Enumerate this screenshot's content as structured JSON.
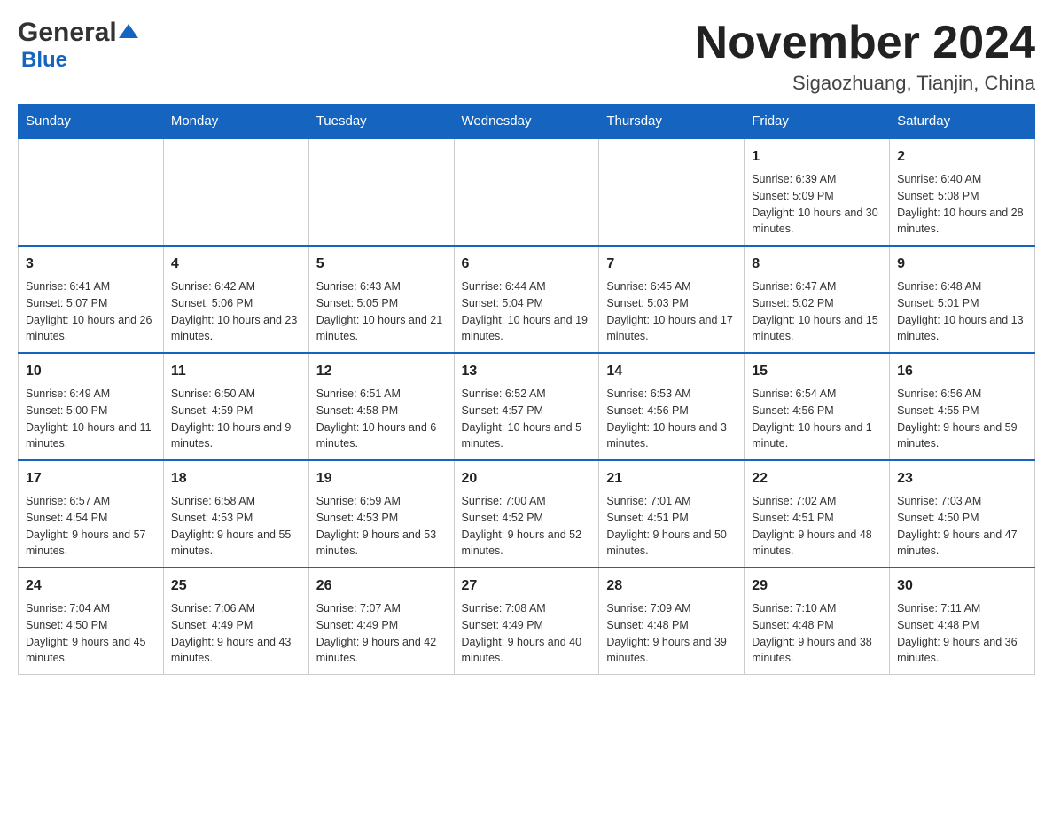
{
  "logo": {
    "text_general": "General",
    "text_blue": "Blue"
  },
  "header": {
    "month_year": "November 2024",
    "location": "Sigaozhuang, Tianjin, China"
  },
  "weekdays": [
    "Sunday",
    "Monday",
    "Tuesday",
    "Wednesday",
    "Thursday",
    "Friday",
    "Saturday"
  ],
  "weeks": [
    [
      {
        "day": "",
        "info": ""
      },
      {
        "day": "",
        "info": ""
      },
      {
        "day": "",
        "info": ""
      },
      {
        "day": "",
        "info": ""
      },
      {
        "day": "",
        "info": ""
      },
      {
        "day": "1",
        "info": "Sunrise: 6:39 AM\nSunset: 5:09 PM\nDaylight: 10 hours and 30 minutes."
      },
      {
        "day": "2",
        "info": "Sunrise: 6:40 AM\nSunset: 5:08 PM\nDaylight: 10 hours and 28 minutes."
      }
    ],
    [
      {
        "day": "3",
        "info": "Sunrise: 6:41 AM\nSunset: 5:07 PM\nDaylight: 10 hours and 26 minutes."
      },
      {
        "day": "4",
        "info": "Sunrise: 6:42 AM\nSunset: 5:06 PM\nDaylight: 10 hours and 23 minutes."
      },
      {
        "day": "5",
        "info": "Sunrise: 6:43 AM\nSunset: 5:05 PM\nDaylight: 10 hours and 21 minutes."
      },
      {
        "day": "6",
        "info": "Sunrise: 6:44 AM\nSunset: 5:04 PM\nDaylight: 10 hours and 19 minutes."
      },
      {
        "day": "7",
        "info": "Sunrise: 6:45 AM\nSunset: 5:03 PM\nDaylight: 10 hours and 17 minutes."
      },
      {
        "day": "8",
        "info": "Sunrise: 6:47 AM\nSunset: 5:02 PM\nDaylight: 10 hours and 15 minutes."
      },
      {
        "day": "9",
        "info": "Sunrise: 6:48 AM\nSunset: 5:01 PM\nDaylight: 10 hours and 13 minutes."
      }
    ],
    [
      {
        "day": "10",
        "info": "Sunrise: 6:49 AM\nSunset: 5:00 PM\nDaylight: 10 hours and 11 minutes."
      },
      {
        "day": "11",
        "info": "Sunrise: 6:50 AM\nSunset: 4:59 PM\nDaylight: 10 hours and 9 minutes."
      },
      {
        "day": "12",
        "info": "Sunrise: 6:51 AM\nSunset: 4:58 PM\nDaylight: 10 hours and 6 minutes."
      },
      {
        "day": "13",
        "info": "Sunrise: 6:52 AM\nSunset: 4:57 PM\nDaylight: 10 hours and 5 minutes."
      },
      {
        "day": "14",
        "info": "Sunrise: 6:53 AM\nSunset: 4:56 PM\nDaylight: 10 hours and 3 minutes."
      },
      {
        "day": "15",
        "info": "Sunrise: 6:54 AM\nSunset: 4:56 PM\nDaylight: 10 hours and 1 minute."
      },
      {
        "day": "16",
        "info": "Sunrise: 6:56 AM\nSunset: 4:55 PM\nDaylight: 9 hours and 59 minutes."
      }
    ],
    [
      {
        "day": "17",
        "info": "Sunrise: 6:57 AM\nSunset: 4:54 PM\nDaylight: 9 hours and 57 minutes."
      },
      {
        "day": "18",
        "info": "Sunrise: 6:58 AM\nSunset: 4:53 PM\nDaylight: 9 hours and 55 minutes."
      },
      {
        "day": "19",
        "info": "Sunrise: 6:59 AM\nSunset: 4:53 PM\nDaylight: 9 hours and 53 minutes."
      },
      {
        "day": "20",
        "info": "Sunrise: 7:00 AM\nSunset: 4:52 PM\nDaylight: 9 hours and 52 minutes."
      },
      {
        "day": "21",
        "info": "Sunrise: 7:01 AM\nSunset: 4:51 PM\nDaylight: 9 hours and 50 minutes."
      },
      {
        "day": "22",
        "info": "Sunrise: 7:02 AM\nSunset: 4:51 PM\nDaylight: 9 hours and 48 minutes."
      },
      {
        "day": "23",
        "info": "Sunrise: 7:03 AM\nSunset: 4:50 PM\nDaylight: 9 hours and 47 minutes."
      }
    ],
    [
      {
        "day": "24",
        "info": "Sunrise: 7:04 AM\nSunset: 4:50 PM\nDaylight: 9 hours and 45 minutes."
      },
      {
        "day": "25",
        "info": "Sunrise: 7:06 AM\nSunset: 4:49 PM\nDaylight: 9 hours and 43 minutes."
      },
      {
        "day": "26",
        "info": "Sunrise: 7:07 AM\nSunset: 4:49 PM\nDaylight: 9 hours and 42 minutes."
      },
      {
        "day": "27",
        "info": "Sunrise: 7:08 AM\nSunset: 4:49 PM\nDaylight: 9 hours and 40 minutes."
      },
      {
        "day": "28",
        "info": "Sunrise: 7:09 AM\nSunset: 4:48 PM\nDaylight: 9 hours and 39 minutes."
      },
      {
        "day": "29",
        "info": "Sunrise: 7:10 AM\nSunset: 4:48 PM\nDaylight: 9 hours and 38 minutes."
      },
      {
        "day": "30",
        "info": "Sunrise: 7:11 AM\nSunset: 4:48 PM\nDaylight: 9 hours and 36 minutes."
      }
    ]
  ]
}
